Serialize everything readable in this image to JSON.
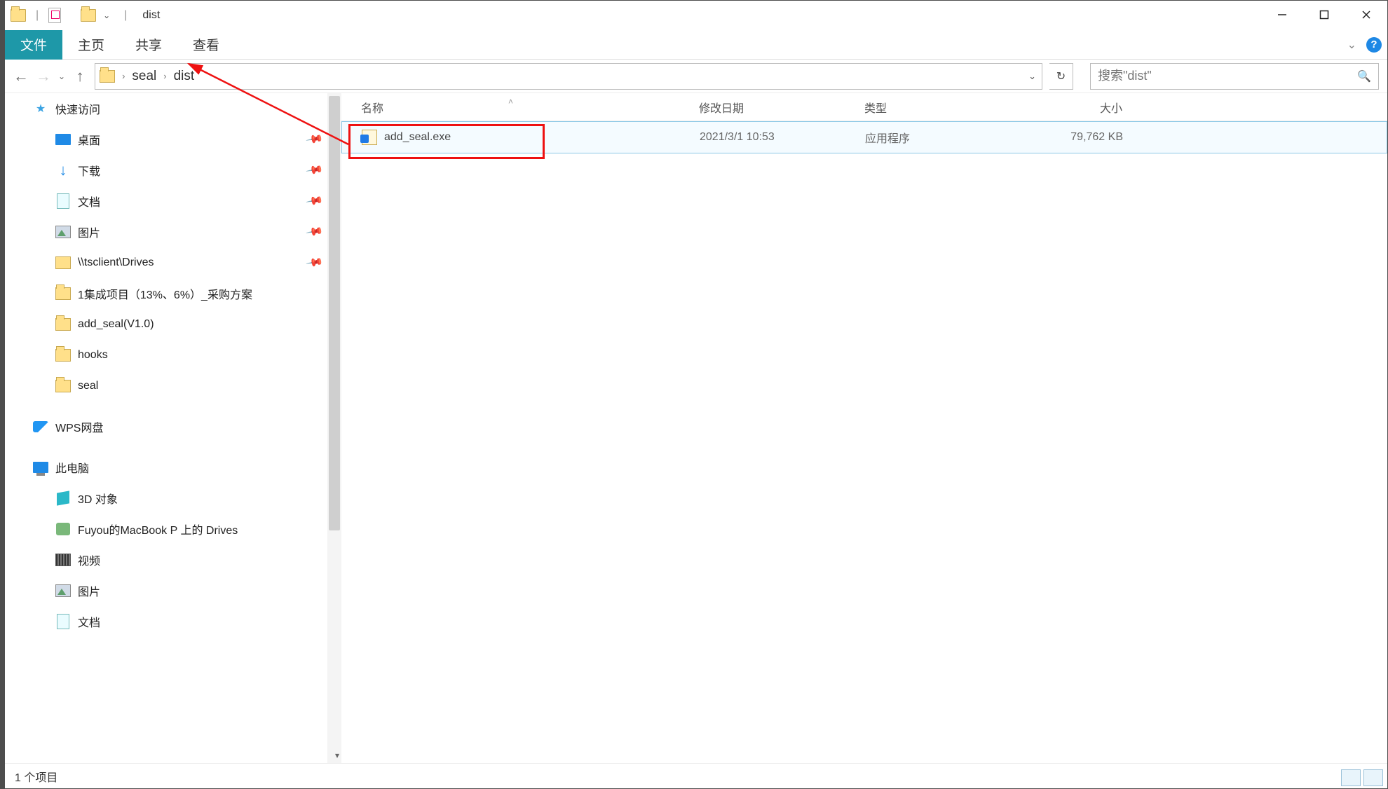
{
  "title": "dist",
  "ribbon": {
    "file": "文件",
    "home": "主页",
    "share": "共享",
    "view": "查看"
  },
  "breadcrumb": {
    "seg1": "seal",
    "seg2": "dist"
  },
  "search_placeholder": "搜索\"dist\"",
  "tree": {
    "quick": "快速访问",
    "desktop": "桌面",
    "downloads": "下载",
    "documents": "文档",
    "pictures": "图片",
    "tsclient": "\\\\tsclient\\Drives",
    "proj": "1集成项目（13%、6%）_采购方案",
    "addseal": "add_seal(V1.0)",
    "hooks": "hooks",
    "seal": "seal",
    "wps": "WPS网盘",
    "thispc": "此电脑",
    "obj3d": "3D 对象",
    "mac": "Fuyou的MacBook P 上的 Drives",
    "video": "视频",
    "pictures2": "图片",
    "documents2": "文档"
  },
  "columns": {
    "name": "名称",
    "date": "修改日期",
    "type": "类型",
    "size": "大小"
  },
  "file": {
    "name": "add_seal.exe",
    "date": "2021/3/1 10:53",
    "type": "应用程序",
    "size": "79,762 KB"
  },
  "status": "1 个项目"
}
